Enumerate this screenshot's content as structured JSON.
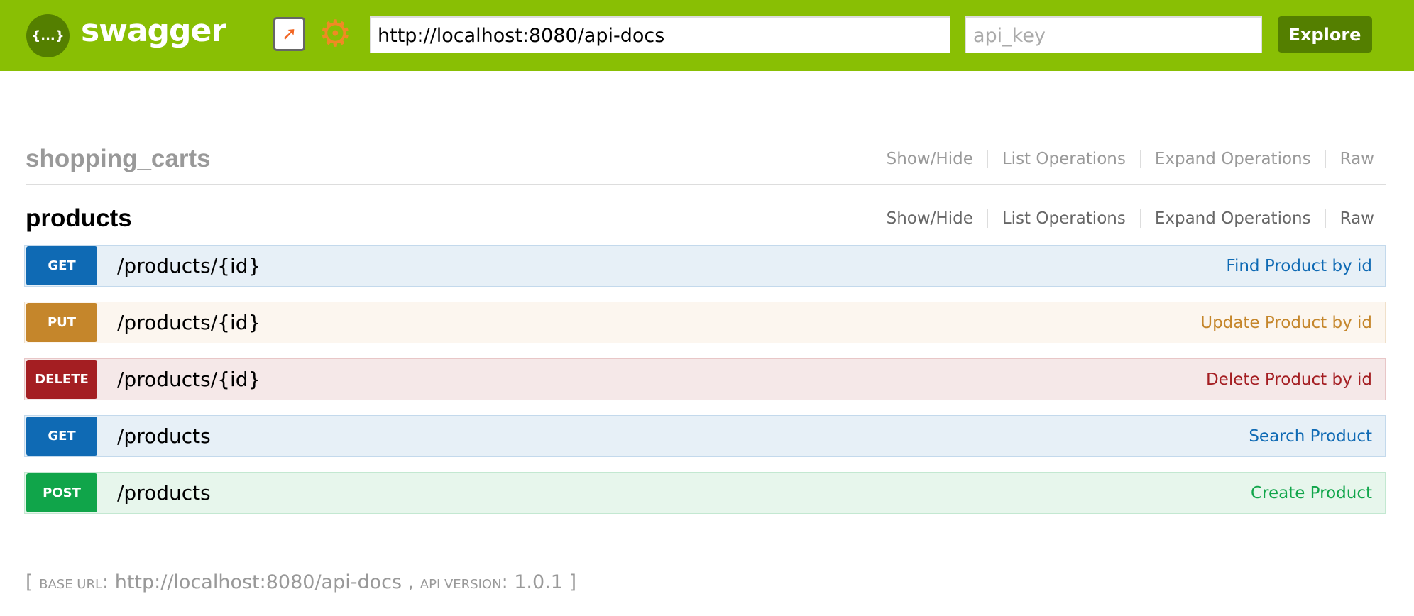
{
  "header": {
    "logo_glyph": "{...}",
    "brand": "swagger",
    "url_value": "http://localhost:8080/api-docs",
    "api_key_placeholder": "api_key",
    "explore_label": "Explore",
    "color": "#89bf04"
  },
  "resources": [
    {
      "name": "shopping_carts",
      "links": [
        "Show/Hide",
        "List Operations",
        "Expand Operations",
        "Raw"
      ]
    },
    {
      "name": "products",
      "links": [
        "Show/Hide",
        "List Operations",
        "Expand Operations",
        "Raw"
      ]
    }
  ],
  "operations": [
    {
      "method": "GET",
      "path": "/products/{id}",
      "summary": "Find Product by id",
      "color": "#0f6ab4"
    },
    {
      "method": "PUT",
      "path": "/products/{id}",
      "summary": "Update Product by id",
      "color": "#c5862b"
    },
    {
      "method": "DELETE",
      "path": "/products/{id}",
      "summary": "Delete Product by id",
      "color": "#a41e22"
    },
    {
      "method": "GET",
      "path": "/products",
      "summary": "Search Product",
      "color": "#0f6ab4"
    },
    {
      "method": "POST",
      "path": "/products",
      "summary": "Create Product",
      "color": "#10a54a"
    }
  ],
  "footer": {
    "open": "[ ",
    "base_url_label": "Base URL",
    "base_url": "http://localhost:8080/api-docs",
    "sep": " , ",
    "api_version_label": "API Version",
    "api_version": "1.0.1",
    "close": " ]"
  }
}
